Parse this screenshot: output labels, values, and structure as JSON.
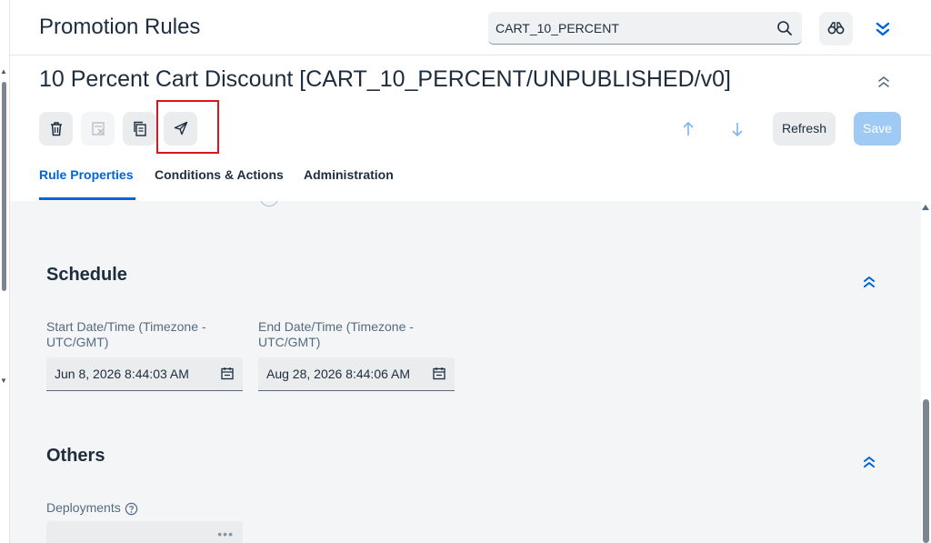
{
  "app": {
    "title": "Promotion Rules"
  },
  "search": {
    "value": "CART_10_PERCENT",
    "icon": "search-icon"
  },
  "object": {
    "title": "10 Percent Cart Discount [CART_10_PERCENT/UNPUBLISHED/v0]"
  },
  "toolbar": {
    "refresh_label": "Refresh",
    "save_label": "Save"
  },
  "tabs": [
    {
      "label": "Rule Properties",
      "active": true
    },
    {
      "label": "Conditions & Actions",
      "active": false
    },
    {
      "label": "Administration",
      "active": false
    }
  ],
  "schedule": {
    "title": "Schedule",
    "start_label": "Start Date/Time (Timezone - UTC/GMT)",
    "start_value": "Jun 8, 2026 8:44:03 AM",
    "end_label": "End Date/Time (Timezone - UTC/GMT)",
    "end_value": "Aug 28, 2026 8:44:06 AM"
  },
  "others": {
    "title": "Others",
    "deployments_label": "Deployments",
    "deployments_dots": "•••"
  },
  "colors": {
    "accent": "#0064d9",
    "highlight": "#d9161e",
    "save_bg": "#9fcaf3"
  }
}
